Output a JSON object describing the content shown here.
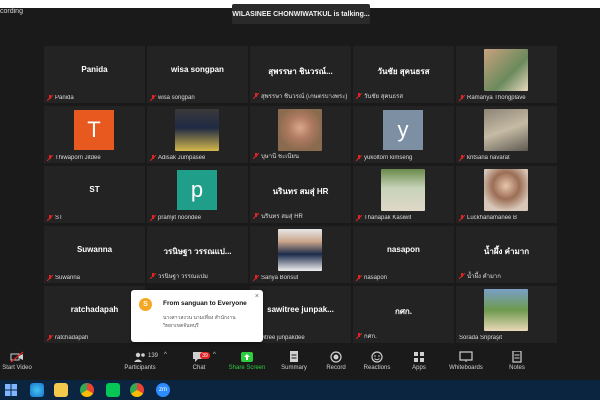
{
  "recording": {
    "label": "cording"
  },
  "talking": "WILASINEE CHONWIWATKUL is talking...",
  "tiles": [
    {
      "big": "Panida",
      "cap": "Panida"
    },
    {
      "big": "wisa songpan",
      "cap": "wisa songpan"
    },
    {
      "big": "สุพรรษา ชินวรณ์...",
      "cap": "สุพรรษา ชินวรณ์ (เกษตรบางพระ)"
    },
    {
      "big": "วันชัย สุคนธรส",
      "cap": "วันชัย สุคนธรส"
    },
    {
      "cap": "Ramanya Thongplave"
    },
    {
      "big": "T",
      "cap": "Thiwaporn Jitdee"
    },
    {
      "cap": "Adisak Jumpasee"
    },
    {
      "cap": "บุษานี ชะเนียน"
    },
    {
      "big": "y",
      "cap": "yukoltorn kimseng"
    },
    {
      "cap": "kritsana navarat"
    },
    {
      "big": "ST",
      "cap": "ST"
    },
    {
      "big": "p",
      "cap": "pramjit noondee"
    },
    {
      "big": "นรินทร สมสุ่ HR",
      "cap": "นรินทร สมสุ่ HR"
    },
    {
      "cap": "Thanapak Kasiwit"
    },
    {
      "cap": "Luckhanamanee B"
    },
    {
      "big": "Suwanna",
      "cap": "Suwanna"
    },
    {
      "big": "วรนิษฐา วรรณแป...",
      "cap": "วรนิษฐา วรรณแปม"
    },
    {
      "cap": "Sanya Borisut"
    },
    {
      "big": "nasapon",
      "cap": "nasapon"
    },
    {
      "big": "น้ำผึ้ง คำมาก",
      "cap": "น้ำผึ้ง คำมาก"
    },
    {
      "big": "ratchadapah",
      "cap": "ratchadapah"
    },
    {
      "big": "sawitree junpak...",
      "cap": "sawitree junpakdee"
    },
    {
      "big": "กศก.",
      "cap": "กศก."
    },
    {
      "cap": "Sorada Sripraşit"
    }
  ],
  "chat_popup": {
    "avatar": "S",
    "from": "From sanguan to Everyone",
    "message": "นางสาวสงวน นามเที่ยง สำนักงาน วิทยาเขตจันทบุรี",
    "close": "×"
  },
  "toolbar": {
    "start_video": "Start Video",
    "participants": "Participants",
    "participants_count": "139",
    "chat": "Chat",
    "chat_badge": "39",
    "share_screen": "Share Screen",
    "summary": "Summary",
    "record": "Record",
    "reactions": "Reactions",
    "apps": "Apps",
    "whiteboards": "Whiteboards",
    "notes": "Notes"
  },
  "taskbar": {
    "zoom_label": "zm"
  },
  "colors": {
    "accent_green": "#2ecc40",
    "mute_red": "#e02424",
    "tile_bg": "#232323"
  }
}
